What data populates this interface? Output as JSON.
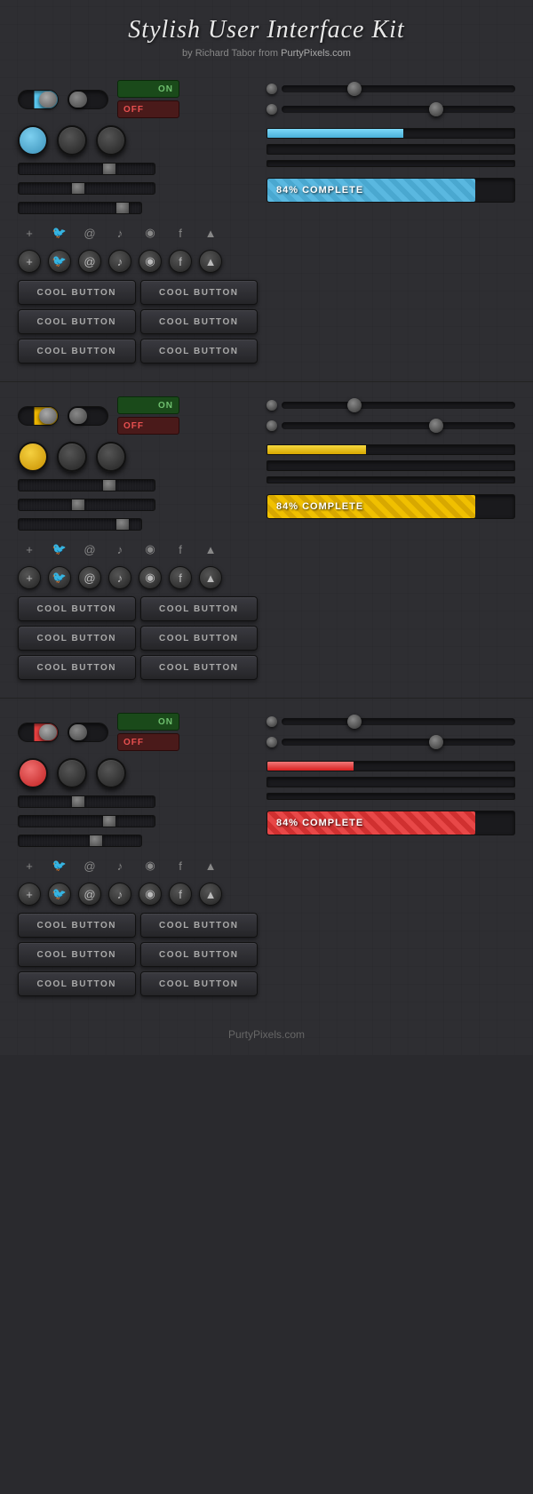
{
  "header": {
    "title": "Stylish User Interface Kit",
    "subtitle": "by Richard Tabor from",
    "link": "PurtyPixels.com"
  },
  "sections": [
    {
      "accent": "blue",
      "accent_color": "#5ac8f0",
      "progress_label": "84% COMPLETE",
      "progress_pct": 84
    },
    {
      "accent": "yellow",
      "accent_color": "#f0b800",
      "progress_label": "84% COMPLETE",
      "progress_pct": 84
    },
    {
      "accent": "red",
      "accent_color": "#e84040",
      "progress_label": "84% COMPLETE",
      "progress_pct": 84
    }
  ],
  "buttons": {
    "label": "COOL BUTTON"
  },
  "social_icons": [
    "+",
    "🐦",
    "@",
    "♪",
    "◉",
    "f",
    "▲"
  ],
  "footer": {
    "text": "PurtyPixels.com"
  }
}
